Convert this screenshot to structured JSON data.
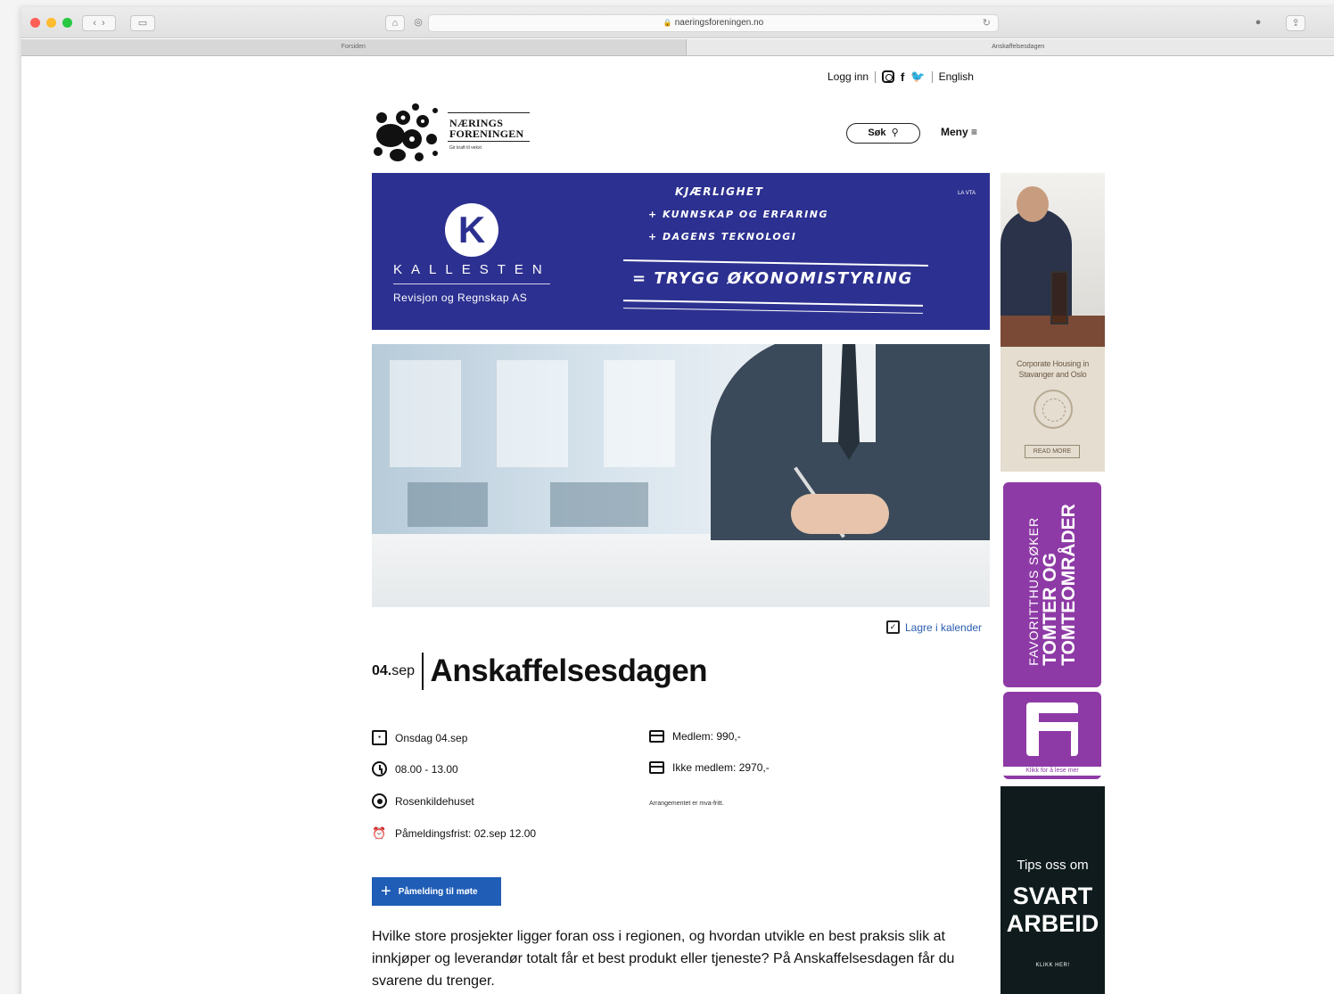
{
  "browser": {
    "url": "naeringsforeningen.no",
    "tabs": [
      "Forsiden",
      "Anskaffelsesdagen"
    ]
  },
  "topnav": {
    "login": "Logg inn",
    "language": "English",
    "social": [
      "instagram-icon",
      "facebook-icon",
      "twitter-icon"
    ]
  },
  "logo": {
    "line1": "NÆRINGS",
    "line2": "FORENINGEN",
    "tagline": "Gir kraft til vekst"
  },
  "header": {
    "search_label": "Søk",
    "menu_label": "Meny"
  },
  "banner_ad": {
    "brand": "KALLESTEN",
    "subtitle": "Revisjon og Regnskap AS",
    "line1": "KJÆRLIGHET",
    "line2": "+ KUNNSKAP OG ERFARING",
    "line3": "+ DAGENS TEKNOLOGI",
    "line4": "= TRYGG ØKONOMISTYRING",
    "tag": "LA VTA",
    "bg_color": "#2c3090"
  },
  "event": {
    "calendar_link": "Lagre i kalender",
    "date_day": "04.",
    "date_month": "sep",
    "title": "Anskaffelsesdagen",
    "details_left": [
      {
        "icon": "calendar-icon",
        "text": "Onsdag 04.sep"
      },
      {
        "icon": "clock-icon",
        "text": "08.00 - 13.00"
      },
      {
        "icon": "location-icon",
        "text": "Rosenkildehuset"
      },
      {
        "icon": "alarm-icon",
        "text": "Påmeldingsfrist: 02.sep 12.00"
      }
    ],
    "details_right": [
      {
        "icon": "card-icon",
        "text": "Medlem: 990,-"
      },
      {
        "icon": "card-icon",
        "text": "Ikke medlem: 2970,-"
      }
    ],
    "note": "Arrangementet er mva-fritt.",
    "register_label": "Påmelding til møte",
    "intro": "Hvilke store prosjekter ligger foran oss i regionen, og hvordan utvikle en best praksis slik at innkjøper og leverandør totalt får et best produkt eller tjeneste? På Anskaffelsesdagen får du svarene du trenger."
  },
  "side_ads": {
    "ad1_text": "Corporate Housing in Stavanger and Oslo",
    "ad1_button": "READ MORE",
    "ad2_line1": "FAVORITTHUS SØKER",
    "ad2_line2": "TOMTER OG",
    "ad2_line3": "TOMTEOMRÅDER",
    "ad3_caption": "Klikk for å lese mer",
    "ad4_line1": "Tips oss om",
    "ad4_line2": "SVART",
    "ad4_line3": "ARBEID",
    "ad4_cta": "KLIKK HER!",
    "accent_purple": "#8e3aa6",
    "accent_blue": "#1f5db6"
  }
}
